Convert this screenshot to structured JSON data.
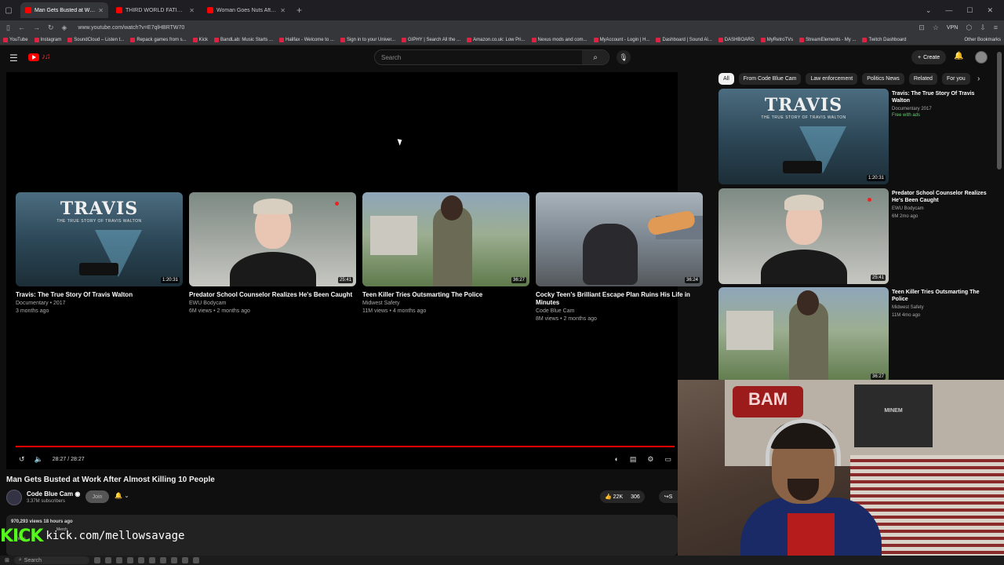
{
  "browser": {
    "tabs": [
      {
        "label": "Man Gets Busted at Work After",
        "active": true
      },
      {
        "label": "THIRD WORLD FATIGUER THR",
        "active": false
      },
      {
        "label": "Woman Goes Nuts After Date G",
        "active": false
      }
    ],
    "url": "www.youtube.com/watch?v=E7qlHBRTW70",
    "vpn_label": "VPN",
    "bookmarks": [
      "YouTube",
      "Instagram",
      "SoundCloud – Listen t...",
      "Repack games from s...",
      "Kick",
      "BandLab: Music Starts ...",
      "Halifax - Welcome to ...",
      "Sign in to your Univer...",
      "GIPHY | Search All the ...",
      "Amazon.co.uk: Low Pri...",
      "Nexus mods and com...",
      "MyAccount - Login | H...",
      "Dashboard | Sound Al...",
      "DASHBOARD",
      "MyRetroTVs",
      "StreamElements - My ...",
      "Twitch Dashboard"
    ],
    "other_bookmarks": "Other Bookmarks"
  },
  "yt": {
    "search_placeholder": "Search",
    "create_label": "Create"
  },
  "endscreen": [
    {
      "title": "Travis: The True Story Of Travis Walton",
      "line1": "Documentary • 2017",
      "line2": "3 months ago",
      "duration": "1:20:31",
      "thumb_big": "TRAVIS",
      "thumb_sub": "THE TRUE STORY OF TRAVIS WALTON"
    },
    {
      "title": "Predator School Counselor Realizes He's Been Caught",
      "line1": "EWU Bodycam",
      "line2": "6M views • 2 months ago",
      "duration": "25:41"
    },
    {
      "title": "Teen Killer Tries Outsmarting The Police",
      "line1": "Midwest Safety",
      "line2": "11M views • 4 months ago",
      "duration": "36:27"
    },
    {
      "title": "Cocky Teen's Brilliant Escape Plan Ruins His Life in Minutes",
      "line1": "Code Blue Cam",
      "line2": "8M views • 2 months ago",
      "duration": "36:24"
    }
  ],
  "player": {
    "time": "28:27 / 28:27",
    "progress": 1.0
  },
  "video": {
    "title": "Man Gets Busted at Work After Almost Killing 10 People",
    "channel": "Code Blue Cam",
    "subscribers": "3.37M subscribers",
    "join_label": "Join",
    "likes": "22K",
    "dislikes": "306",
    "share_label": "S",
    "views": "970,293 views  18 hours ago",
    "merch": "Merch",
    "desc_bit": "...more"
  },
  "overlay": {
    "kick_logo": "KICK",
    "kick_url": "kick.com/mellowsavage"
  },
  "chips": [
    "All",
    "From Code Blue Cam",
    "Law enforcement",
    "Politics News",
    "Related",
    "For you"
  ],
  "sidebar": [
    {
      "title": "Travis: The True Story Of Travis Walton",
      "meta": "Documentary 2017",
      "extra": "Free with ads",
      "duration": "1:20:31",
      "thumb_big": "TRAVIS",
      "thumb_sub": "THE TRUE STORY OF TRAVIS WALTON"
    },
    {
      "title": "Predator School Counselor Realizes He's Been Caught",
      "meta": "EWU Bodycam",
      "meta2": "6M  2mo ago",
      "duration": "25:41"
    },
    {
      "title": "Teen Killer Tries Outsmarting The Police",
      "meta": "Midwest Safety",
      "meta2": "11M  4mo ago",
      "duration": "36:27"
    }
  ],
  "webcam": {
    "sign_text": "BAM",
    "poster_text": "MINEM"
  },
  "taskbar": {
    "search_label": "Search"
  }
}
